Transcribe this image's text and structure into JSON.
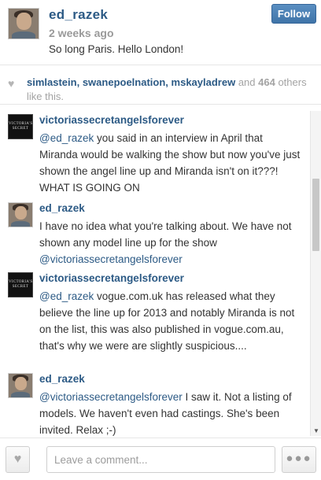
{
  "post": {
    "username": "ed_razek",
    "time_ago": "2 weeks ago",
    "caption": "So long Paris. Hello London!",
    "follow_label": "Follow"
  },
  "likes": {
    "users": [
      "simlastein",
      "swanepoelnation",
      "mskayladrew"
    ],
    "sep1": ", ",
    "sep2": ", ",
    "and_text": " and ",
    "count": "464",
    "others_text": " others like this."
  },
  "comments": [
    {
      "username": "victoriassecretangelsforever",
      "avatar": "victorias-secret-logo",
      "mention": "@ed_razek",
      "text": " you said in an interview in April that Miranda would be walking the show but now you've just shown the angel line up and Miranda isn't on it???! WHAT IS GOING ON"
    },
    {
      "username": "ed_razek",
      "avatar": "ed-razek-photo",
      "text": "I have no idea what you're talking about. We have not shown any model line up for the show ",
      "mention": "@victoriassecretangelsforever"
    },
    {
      "username": "victoriassecretangelsforever",
      "avatar": "victorias-secret-logo",
      "mention": "@ed_razek",
      "text": " vogue.com.uk has released what they believe the line up for 2013 and notably Miranda is not on the list, this was also published in vogue.com.au, that's why we were are slightly suspicious...."
    },
    {
      "username": "ed_razek",
      "avatar": "ed-razek-photo",
      "mention": "@victoriassecretangelsforever",
      "text": " I saw it. Not a listing of models. We haven't even had castings. She's been invited. Relax ;-)"
    }
  ],
  "vs_logo_text": "VICTORIA'S SECRET",
  "footer": {
    "comment_placeholder": "Leave a comment...",
    "like_icon": "heart-icon",
    "more_icon": "ellipsis-icon"
  },
  "colors": {
    "link_blue": "#2c5a85",
    "follow_button": "#4a7fb5"
  }
}
